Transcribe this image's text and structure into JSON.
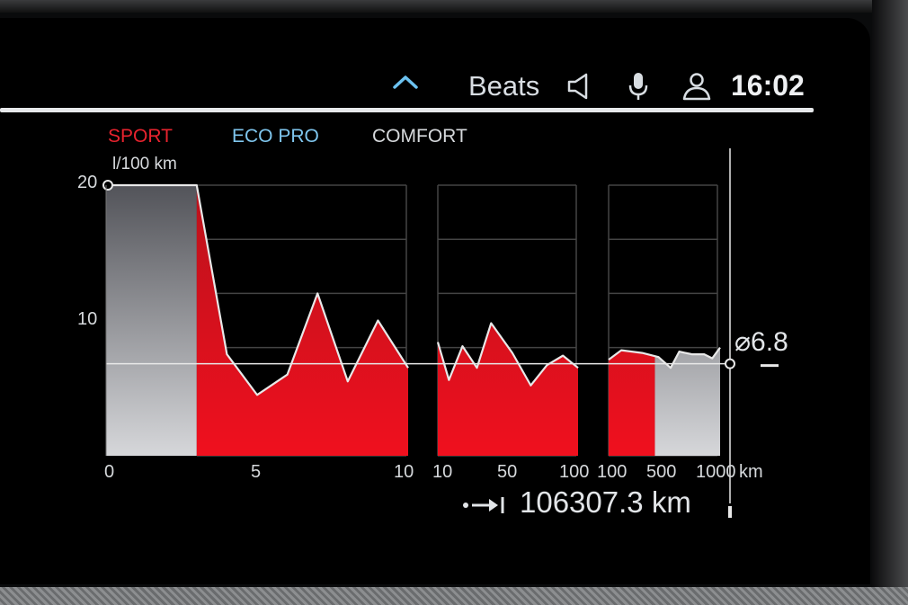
{
  "status_bar": {
    "audio_source": "Beats",
    "clock": "16:02",
    "icons": [
      "chevron-up-icon",
      "speaker-icon",
      "microphone-icon",
      "user-profile-icon"
    ]
  },
  "modes": [
    {
      "label": "SPORT",
      "color": "#e8232e"
    },
    {
      "label": "ECO PRO",
      "color": "#7fc6ee"
    },
    {
      "label": "COMFORT",
      "color": "#d6d9dc"
    }
  ],
  "colors": {
    "accent_red": "#e0101e",
    "grey_fill": "#c8c9cc",
    "line": "#e8e8e8"
  },
  "chart_data": {
    "type": "area",
    "ylabel": "l/100 km",
    "y_ticks": [
      "20",
      "10"
    ],
    "ylim": [
      0,
      20
    ],
    "average": {
      "label": "⌀6.8",
      "value": 6.8
    },
    "panels": [
      {
        "x_ticks": [
          "0",
          "5",
          "10"
        ],
        "x_scale": "linear",
        "xlim": [
          0,
          10
        ],
        "points": [
          [
            0,
            20
          ],
          [
            3,
            20
          ],
          [
            4,
            7.5
          ],
          [
            5,
            4.5
          ],
          [
            6,
            6
          ],
          [
            7,
            12
          ],
          [
            8,
            5.5
          ],
          [
            9,
            10
          ],
          [
            10,
            6.5
          ]
        ],
        "grey_until": 3
      },
      {
        "x_ticks": [
          "10",
          "50",
          "100"
        ],
        "x_scale": "log",
        "xlim": [
          10,
          100
        ],
        "points": [
          [
            10,
            8.4
          ],
          [
            12,
            5.6
          ],
          [
            15,
            8.1
          ],
          [
            19,
            6.5
          ],
          [
            24,
            9.8
          ],
          [
            34,
            7.6
          ],
          [
            46,
            5.2
          ],
          [
            60,
            6.7
          ],
          [
            78,
            7.4
          ],
          [
            100,
            6.5
          ]
        ],
        "grey_until": 10
      },
      {
        "x_ticks": [
          "100",
          "500",
          "1000"
        ],
        "x_scale": "log",
        "xlim": [
          100,
          1000
        ],
        "x_unit": "km",
        "points": [
          [
            100,
            7.1
          ],
          [
            130,
            7.8
          ],
          [
            200,
            7.6
          ],
          [
            280,
            7.3
          ],
          [
            360,
            6.5
          ],
          [
            430,
            7.7
          ],
          [
            560,
            7.5
          ],
          [
            720,
            7.5
          ],
          [
            850,
            7.2
          ],
          [
            1000,
            8.0
          ]
        ],
        "grey_until": 260,
        "red_first": true
      }
    ]
  },
  "odometer": {
    "value": "106307.3",
    "unit": "km"
  }
}
